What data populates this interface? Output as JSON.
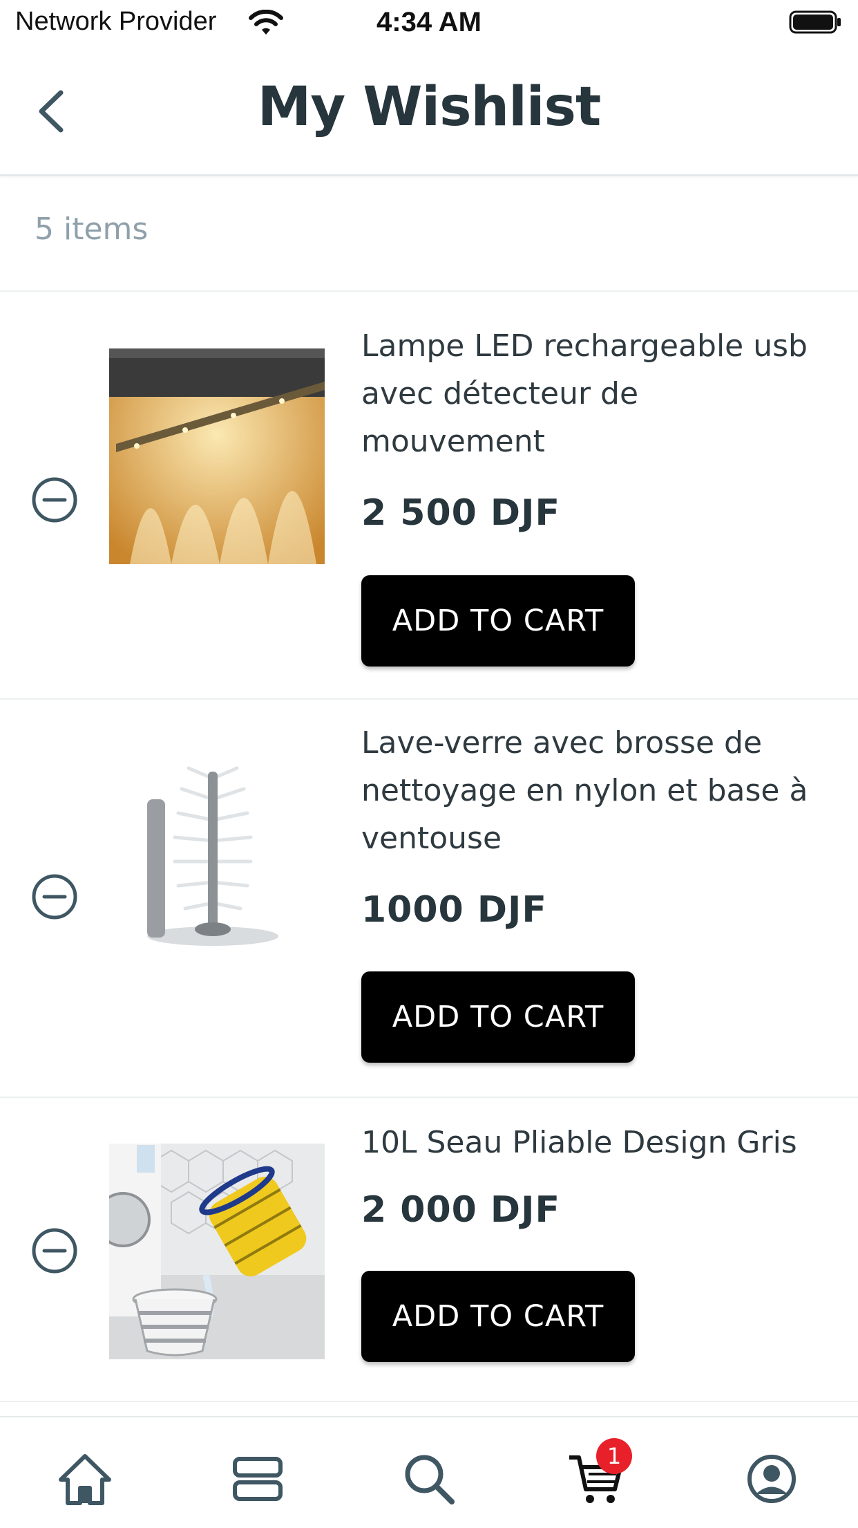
{
  "status": {
    "carrier": "Network Provider",
    "time": "4:34 AM"
  },
  "header": {
    "title": "My Wishlist",
    "back_icon": "chevron-left-icon"
  },
  "summary": {
    "count": "5 items"
  },
  "items": [
    {
      "title": "Lampe LED rechargeable usb avec détecteur de mouvement",
      "price": "2 500  DJF",
      "button": "ADD TO CART"
    },
    {
      "title": "Lave-verre avec brosse de nettoyage en nylon et base à ventouse",
      "price": "1000  DJF",
      "button": "ADD TO CART"
    },
    {
      "title": "10L Seau Pliable Design Gris",
      "price": "2 000  DJF",
      "button": "ADD TO CART"
    }
  ],
  "tabbar": {
    "tabs": [
      "home-icon",
      "categories-icon",
      "search-icon",
      "cart-icon",
      "profile-icon"
    ],
    "cart_badge": "1"
  },
  "colors": {
    "accent": "#000000",
    "badge": "#e8202a",
    "icon": "#3f5663"
  }
}
